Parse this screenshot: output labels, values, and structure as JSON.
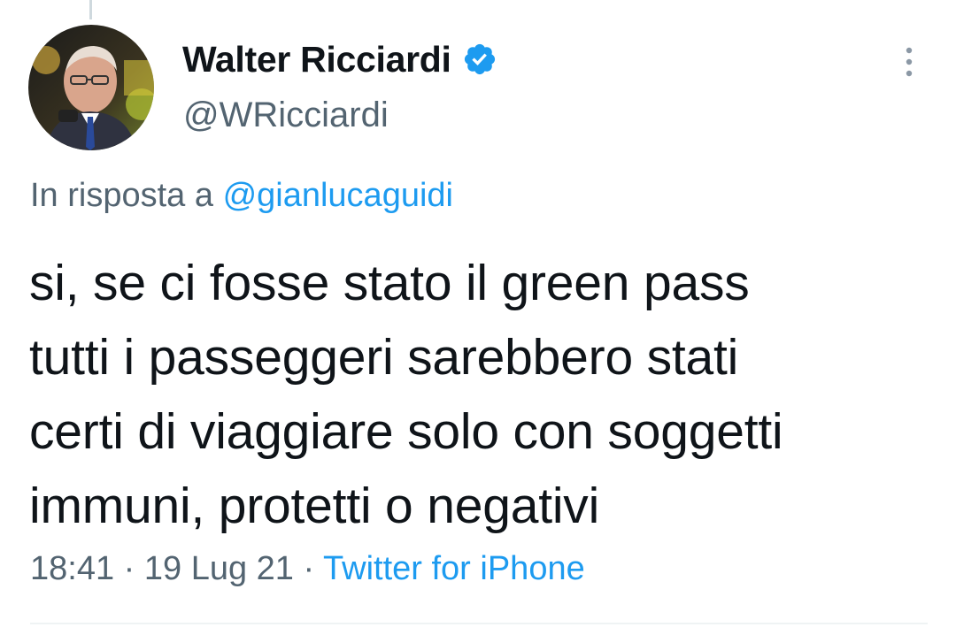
{
  "author": {
    "display_name": "Walter Ricciardi",
    "handle": "@WRicciardi",
    "verified": true,
    "avatar_icon": "profile-photo"
  },
  "reply": {
    "prefix": "In risposta a",
    "mention": "@gianlucaguidi"
  },
  "tweet": {
    "lines": [
      "si, se ci fosse stato il green pass",
      "tutti i passeggeri sarebbero stati",
      "certi di viaggiare solo con soggetti",
      "immuni, protetti o negativi"
    ]
  },
  "meta": {
    "time": "18:41",
    "separator": " · ",
    "date": "19 Lug 21",
    "source": "Twitter for iPhone"
  },
  "colors": {
    "text_primary": "#0f1419",
    "text_secondary": "#536471",
    "accent": "#1d9bf0"
  }
}
